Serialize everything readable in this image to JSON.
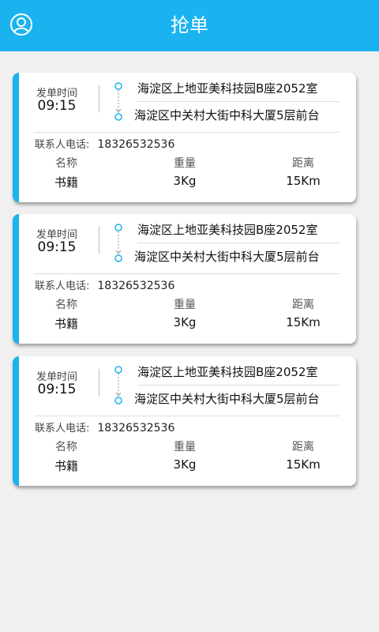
{
  "header": {
    "title": "抢单",
    "avatar_icon": "user-icon"
  },
  "accent": "#1ab3f0",
  "orders": [
    {
      "time_label": "发单时间",
      "time": "09:15",
      "from": "海淀区上地亚美科技园B座2052室",
      "to": "海淀区中关村大街中科大厦5层前台",
      "phone_label": "联系人电话:",
      "phone": "18326532536",
      "name_label": "名称",
      "name": "书籍",
      "weight_label": "重量",
      "weight": "3Kg",
      "distance_label": "距离",
      "distance": "15Km"
    },
    {
      "time_label": "发单时间",
      "time": "09:15",
      "from": "海淀区上地亚美科技园B座2052室",
      "to": "海淀区中关村大街中科大厦5层前台",
      "phone_label": "联系人电话:",
      "phone": "18326532536",
      "name_label": "名称",
      "name": "书籍",
      "weight_label": "重量",
      "weight": "3Kg",
      "distance_label": "距离",
      "distance": "15Km"
    },
    {
      "time_label": "发单时间",
      "time": "09:15",
      "from": "海淀区上地亚美科技园B座2052室",
      "to": "海淀区中关村大街中科大厦5层前台",
      "phone_label": "联系人电话:",
      "phone": "18326532536",
      "name_label": "名称",
      "name": "书籍",
      "weight_label": "重量",
      "weight": "3Kg",
      "distance_label": "距离",
      "distance": "15Km"
    }
  ]
}
